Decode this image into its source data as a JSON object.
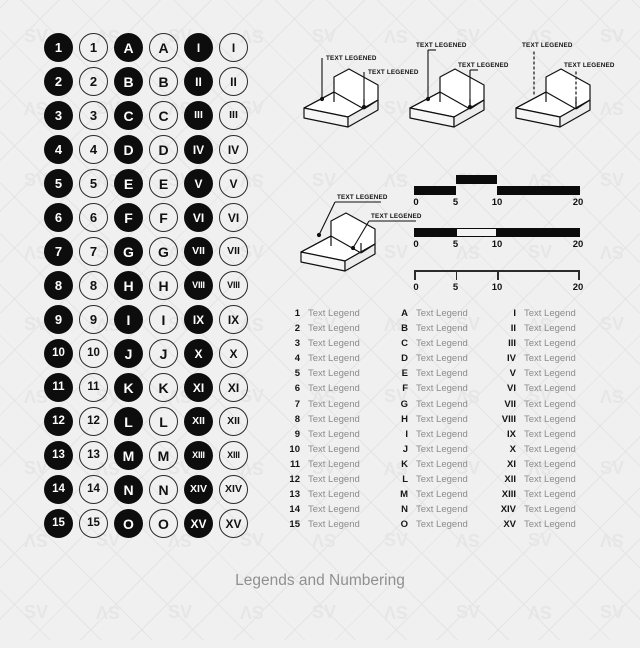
{
  "page": {
    "footer_title": "Legends and Numbering",
    "background_color": "#f0f0f0",
    "watermark_text": "SV",
    "watermark_color": "#e6e6e6"
  },
  "badges": {
    "filled_color": "#0d0d0d",
    "outline_color": "#2a2a2a",
    "columns": [
      {
        "name": "numbers-filled",
        "style": "filled",
        "kind": "num",
        "labels": [
          "1",
          "2",
          "3",
          "4",
          "5",
          "6",
          "7",
          "8",
          "9",
          "10",
          "11",
          "12",
          "13",
          "14",
          "15"
        ]
      },
      {
        "name": "numbers-outline",
        "style": "outline",
        "kind": "num",
        "labels": [
          "1",
          "2",
          "3",
          "4",
          "5",
          "6",
          "7",
          "8",
          "9",
          "10",
          "11",
          "12",
          "13",
          "14",
          "15"
        ]
      },
      {
        "name": "letters-filled",
        "style": "filled",
        "kind": "alpha",
        "labels": [
          "A",
          "B",
          "C",
          "D",
          "E",
          "F",
          "G",
          "H",
          "I",
          "J",
          "K",
          "L",
          "M",
          "N",
          "O"
        ]
      },
      {
        "name": "letters-outline",
        "style": "outline",
        "kind": "alpha",
        "labels": [
          "A",
          "B",
          "C",
          "D",
          "E",
          "F",
          "G",
          "H",
          "I",
          "J",
          "K",
          "L",
          "M",
          "N",
          "O"
        ]
      },
      {
        "name": "romans-filled",
        "style": "filled",
        "kind": "roman",
        "labels": [
          "I",
          "II",
          "III",
          "IV",
          "V",
          "VI",
          "VII",
          "VIII",
          "IX",
          "X",
          "XI",
          "XII",
          "XIII",
          "XIV",
          "XV"
        ]
      },
      {
        "name": "romans-outline",
        "style": "outline",
        "kind": "roman",
        "labels": [
          "I",
          "II",
          "III",
          "IV",
          "V",
          "VI",
          "VII",
          "VIII",
          "IX",
          "X",
          "XI",
          "XII",
          "XIII",
          "XIV",
          "XV"
        ]
      }
    ]
  },
  "diagrams": [
    {
      "name": "iso-callout-vertical-solid",
      "leader_style": "solid-vertical",
      "labels": [
        "TEXT LEGENED",
        "TEXT LEGENED"
      ]
    },
    {
      "name": "iso-callout-vertical-solid-2",
      "leader_style": "solid-vertical",
      "labels": [
        "TEXT LEGENED",
        "TEXT LEGENED"
      ]
    },
    {
      "name": "iso-callout-dotted",
      "leader_style": "dotted-vertical",
      "labels": [
        "TEXT LEGENED",
        "TEXT LEGENED"
      ]
    },
    {
      "name": "iso-callout-diagonal",
      "leader_style": "diagonal-underline",
      "labels": [
        "TEXT LEGENED",
        "TEXT LEGENED"
      ]
    }
  ],
  "scalebars": [
    {
      "name": "scalebar-stepped",
      "ticks": [
        "0",
        "5",
        "10",
        "20"
      ],
      "tick_values": [
        0,
        5,
        10,
        20
      ],
      "max": 20,
      "style": "stepped"
    },
    {
      "name": "scalebar-hollow",
      "ticks": [
        "0",
        "5",
        "10",
        "20"
      ],
      "tick_values": [
        0,
        5,
        10,
        20
      ],
      "max": 20,
      "style": "hollow-segment"
    },
    {
      "name": "scalebar-ruler",
      "ticks": [
        "0",
        "5",
        "10",
        "20"
      ],
      "tick_values": [
        0,
        5,
        10,
        20
      ],
      "max": 20,
      "style": "ruler"
    }
  ],
  "legend_lists": [
    {
      "name": "legend-list-numbers",
      "keys": [
        "1",
        "2",
        "3",
        "4",
        "5",
        "6",
        "7",
        "8",
        "9",
        "10",
        "11",
        "12",
        "13",
        "14",
        "15"
      ],
      "values": [
        "Text Legend",
        "Text Legend",
        "Text Legend",
        "Text Legend",
        "Text Legend",
        "Text Legend",
        "Text Legend",
        "Text Legend",
        "Text Legend",
        "Text Legend",
        "Text Legend",
        "Text Legend",
        "Text Legend",
        "Text Legend",
        "Text Legend"
      ]
    },
    {
      "name": "legend-list-letters",
      "keys": [
        "A",
        "B",
        "C",
        "D",
        "E",
        "F",
        "G",
        "H",
        "I",
        "J",
        "K",
        "L",
        "M",
        "N",
        "O"
      ],
      "values": [
        "Text Legend",
        "Text Legend",
        "Text Legend",
        "Text Legend",
        "Text Legend",
        "Text Legend",
        "Text Legend",
        "Text Legend",
        "Text Legend",
        "Text Legend",
        "Text Legend",
        "Text Legend",
        "Text Legend",
        "Text Legend",
        "Text Legend"
      ]
    },
    {
      "name": "legend-list-romans",
      "keys": [
        "I",
        "II",
        "III",
        "IV",
        "V",
        "VI",
        "VII",
        "VIII",
        "IX",
        "X",
        "XI",
        "XII",
        "XIII",
        "XIV",
        "XV"
      ],
      "values": [
        "Text Legend",
        "Text Legend",
        "Text Legend",
        "Text Legend",
        "Text Legend",
        "Text Legend",
        "Text Legend",
        "Text Legend",
        "Text Legend",
        "Text Legend",
        "Text Legend",
        "Text Legend",
        "Text Legend",
        "Text Legend",
        "Text Legend"
      ]
    }
  ]
}
